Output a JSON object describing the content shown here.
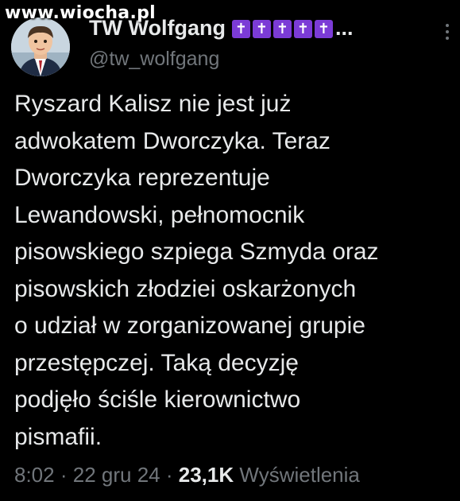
{
  "watermark": "www.wiocha.pl",
  "author": {
    "display_name": "TW Wolfgang",
    "badges": [
      "✝",
      "✝",
      "✝",
      "✝",
      "✝"
    ],
    "ellipsis": "...",
    "handle": "@tw_wolfgang"
  },
  "tweet": {
    "lines": [
      "Ryszard Kalisz nie jest już",
      "adwokatem Dworczyka. Teraz",
      "Dworczyka reprezentuje",
      "Lewandowski, pełnomocnik",
      "pisowskiego szpiega Szmyda oraz",
      "pisowskich złodziei oskarżonych",
      "o udział w zorganizowanej grupie",
      "przestępczej. Taką decyzję",
      "podjęło ściśle kierownictwo",
      "pismafii."
    ]
  },
  "meta": {
    "time": "8:02",
    "separator": "·",
    "date": "22 gru 24",
    "views_count": "23,1K",
    "views_label": "Wyświetlenia"
  },
  "colors": {
    "background": "#000000",
    "text": "#e7e9ea",
    "secondary": "#71767b",
    "badge": "#7b3bd6"
  },
  "icons": {
    "more": "more-dots-vertical-icon"
  }
}
